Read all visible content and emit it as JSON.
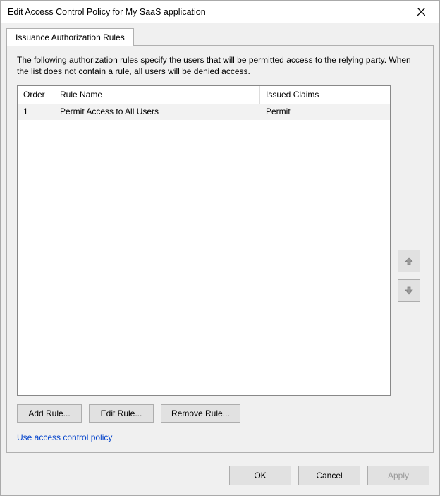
{
  "window": {
    "title": "Edit Access Control Policy for My SaaS application"
  },
  "tabs": {
    "issuance": "Issuance Authorization Rules"
  },
  "panel": {
    "description": "The following authorization rules specify the users that will be permitted access to the relying party. When the list does not contain a rule, all users will be denied access."
  },
  "table": {
    "headers": {
      "order": "Order",
      "name": "Rule Name",
      "claims": "Issued Claims"
    },
    "rows": [
      {
        "order": "1",
        "name": "Permit Access to All Users",
        "claims": "Permit"
      }
    ]
  },
  "buttons": {
    "add": "Add Rule...",
    "edit": "Edit Rule...",
    "remove": "Remove Rule..."
  },
  "link": {
    "policy": "Use access control policy"
  },
  "footer": {
    "ok": "OK",
    "cancel": "Cancel",
    "apply": "Apply"
  }
}
